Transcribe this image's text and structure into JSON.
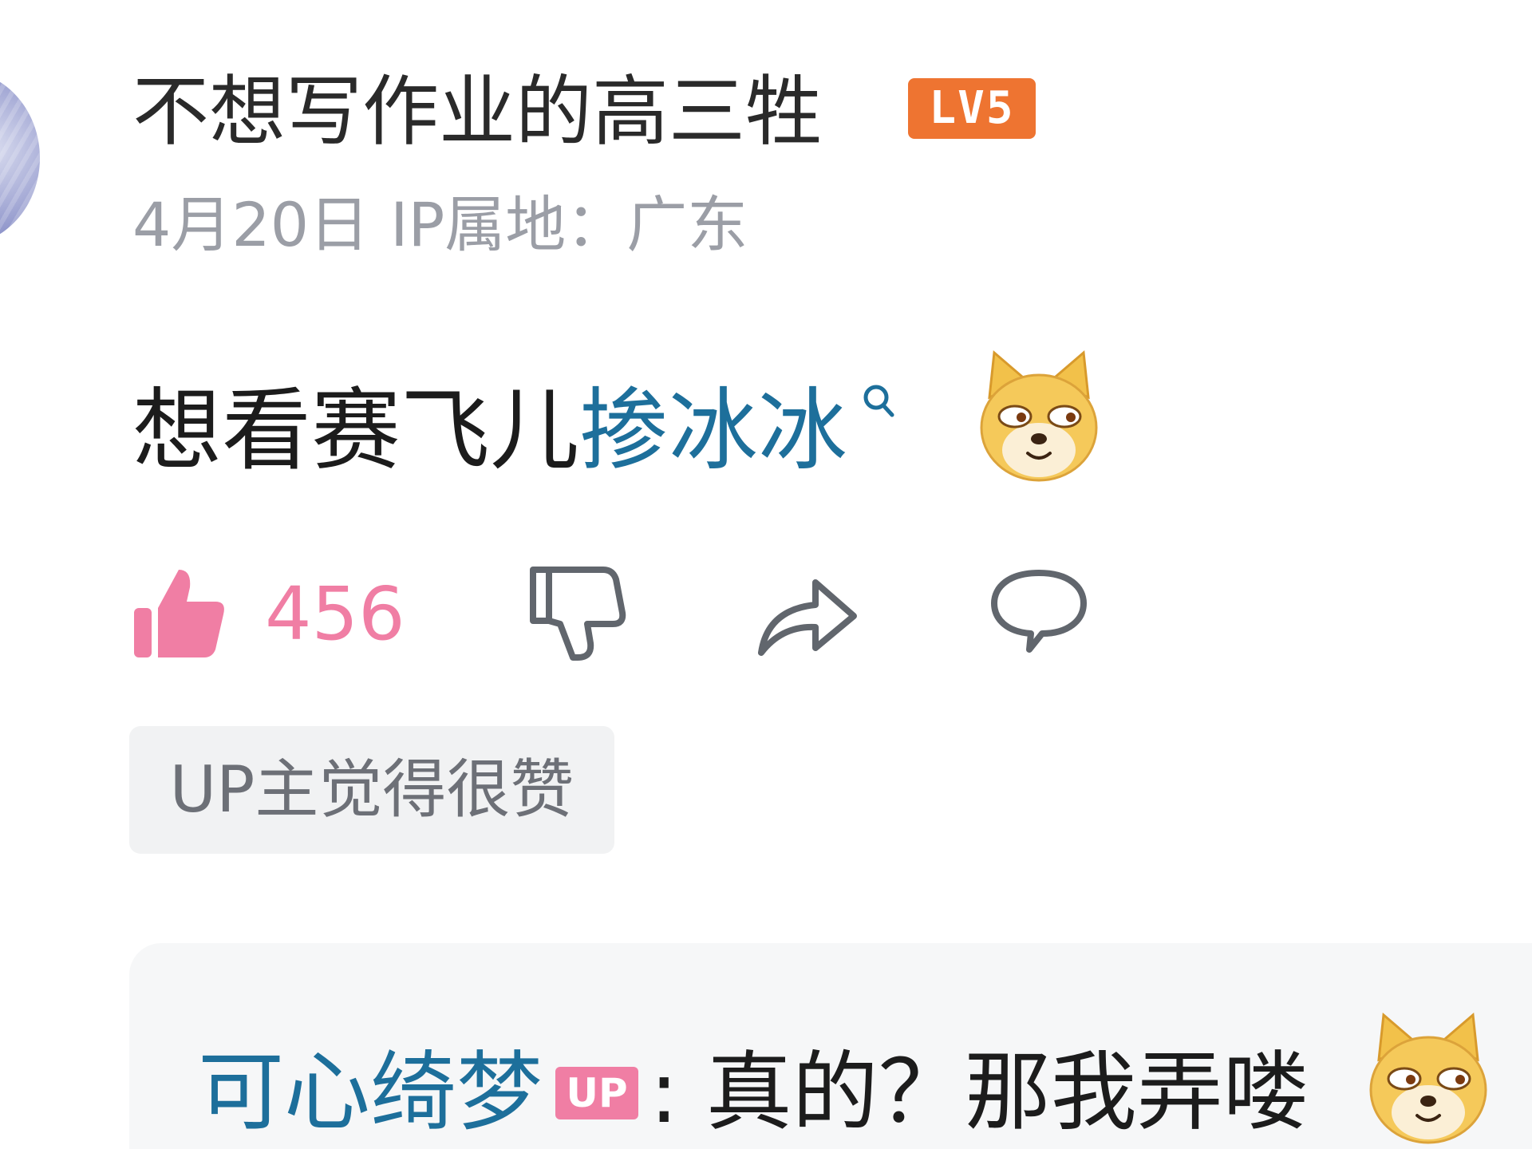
{
  "comment": {
    "author": {
      "name": "不想写作业的高三牲",
      "level_badge": "LV5",
      "avatar_icon": "avatar-image"
    },
    "date": "4月20日",
    "ip_location": "IP属地：广东",
    "text_before_link": "想看赛飞儿",
    "link_text": "掺冰冰",
    "emoji": "doge-emoji",
    "actions": {
      "like_count": "456",
      "like_icon": "thumbs-up-icon",
      "dislike_icon": "thumbs-down-icon",
      "share_icon": "share-icon",
      "reply_icon": "comment-icon"
    },
    "up_liked_tag": "UP主觉得很赞"
  },
  "reply": {
    "author_name": "可心绮梦",
    "badge": "UP",
    "separator": ": ",
    "text": "真的？那我弄喽",
    "emoji": "doge-emoji"
  },
  "colors": {
    "level_badge": "#ee7431",
    "link": "#1d6f9b",
    "like_pink": "#f07ea4",
    "meta_gray": "#9b9ea6"
  }
}
